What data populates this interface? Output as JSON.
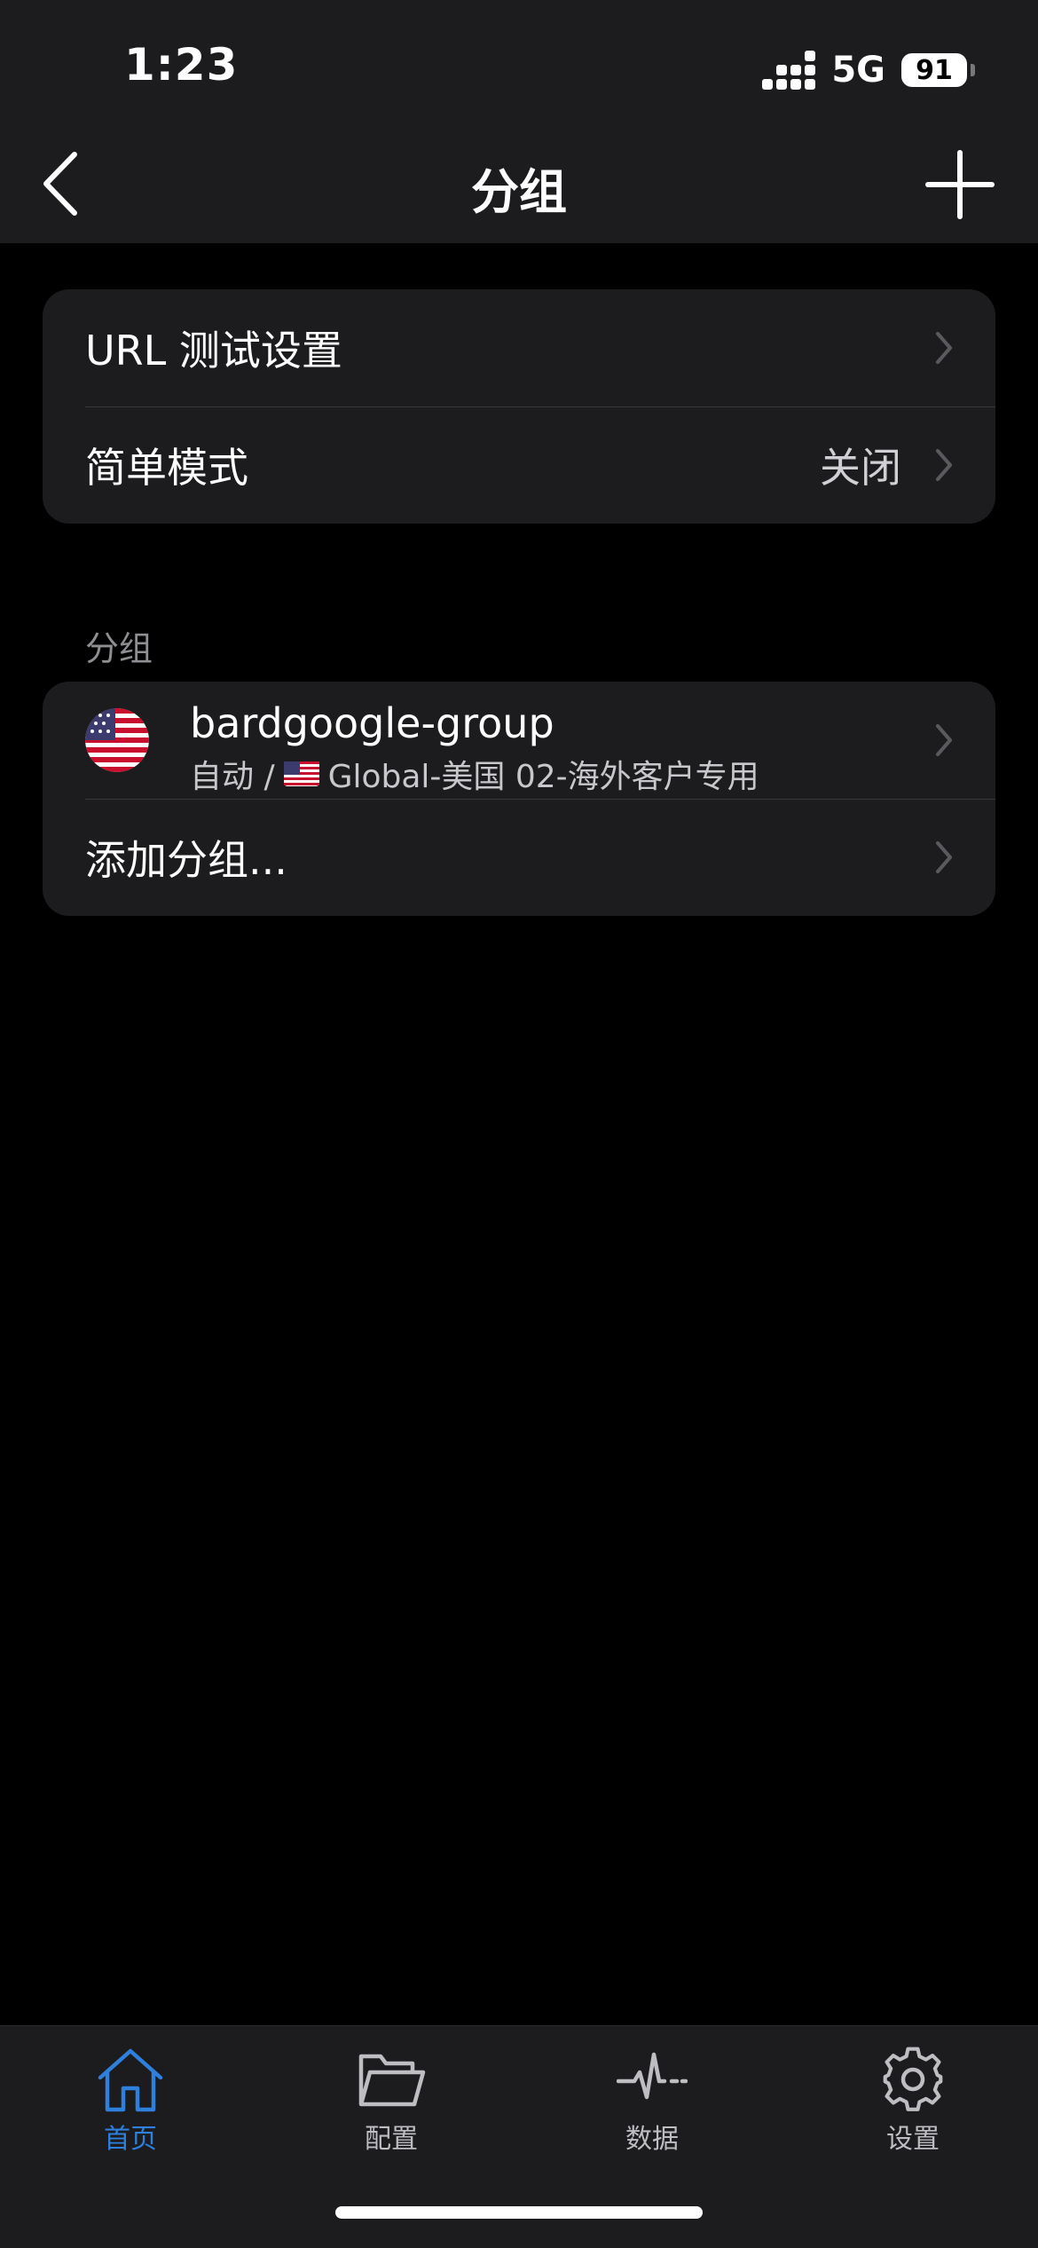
{
  "status_bar": {
    "time": "1:23",
    "network": "5G",
    "battery": "91"
  },
  "nav": {
    "title": "分组",
    "back_icon": "chevron-left-icon",
    "add_icon": "plus-icon"
  },
  "settings": {
    "items": [
      {
        "label": "URL 测试设置",
        "value": ""
      },
      {
        "label": "简单模式",
        "value": "关闭"
      }
    ]
  },
  "groups": {
    "section_header": "分组",
    "items": [
      {
        "name": "bardgoogle-group",
        "mode": "自动 /",
        "node": "Global-美国 02-海外客户专用",
        "flag_icon": "us-flag-icon"
      }
    ],
    "add_label": "添加分组..."
  },
  "tab_bar": {
    "accent_color": "#2f7fdc",
    "inactive_color": "#bdbdc2",
    "tabs": [
      {
        "label": "首页",
        "icon": "home-icon",
        "active": true
      },
      {
        "label": "配置",
        "icon": "folder-icon",
        "active": false
      },
      {
        "label": "数据",
        "icon": "activity-icon",
        "active": false
      },
      {
        "label": "设置",
        "icon": "gear-icon",
        "active": false
      }
    ]
  }
}
